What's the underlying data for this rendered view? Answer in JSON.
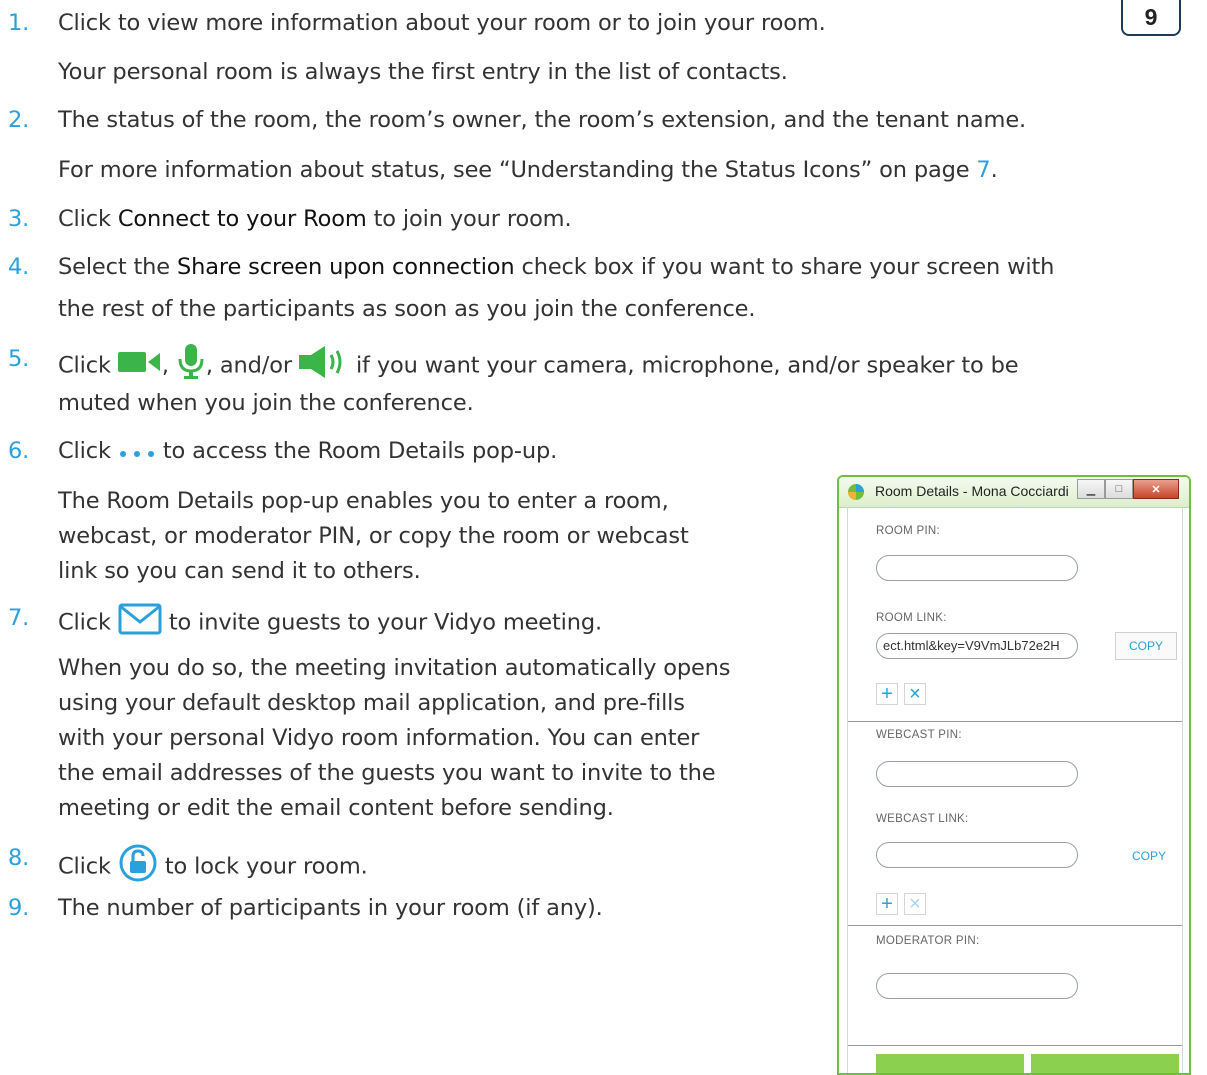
{
  "page_number": "9",
  "items": [
    {
      "num": "1.",
      "lines": [
        {
          "parts": [
            {
              "t": "Click to view more information about your room or to join your room."
            }
          ]
        },
        {
          "parts": [
            {
              "t": "Your personal room is always the first entry in the list of contacts."
            }
          ]
        }
      ]
    },
    {
      "num": "2.",
      "lines": [
        {
          "parts": [
            {
              "t": "The status of the room, the room’s owner, the room’s extension, and the tenant name."
            }
          ]
        },
        {
          "parts": [
            {
              "t": "For more information about status, see “Understanding the Status Icons” on page "
            },
            {
              "t": "7",
              "c": "blue"
            },
            {
              "t": "."
            }
          ]
        }
      ]
    },
    {
      "num": "3.",
      "lines": [
        {
          "parts": [
            {
              "t": "Click "
            },
            {
              "t": "Connect to your Room",
              "c": "hl"
            },
            {
              "t": " to join your room."
            }
          ]
        }
      ]
    },
    {
      "num": "4.",
      "lines": [
        {
          "parts": [
            {
              "t": "Select the "
            },
            {
              "t": "Share screen upon connection",
              "c": "hl"
            },
            {
              "t": " check box if you want to share your screen with"
            }
          ]
        },
        {
          "parts": [
            {
              "t": "the rest of the participants as soon as you join the conference."
            }
          ]
        }
      ]
    },
    {
      "num": "5.",
      "lines": [
        {
          "parts": [
            {
              "t": "Click "
            },
            {
              "icon": "camera-icon"
            },
            {
              "t": ", "
            },
            {
              "icon": "microphone-icon"
            },
            {
              "t": ", and/or "
            },
            {
              "icon": "speaker-icon"
            },
            {
              "t": " if you want your camera, microphone, and/or speaker to be"
            }
          ]
        },
        {
          "parts": [
            {
              "t": "muted when you join the conference."
            }
          ]
        }
      ]
    },
    {
      "num": "6.",
      "lines": [
        {
          "parts": [
            {
              "t": "Click "
            },
            {
              "icon": "more-dots-icon"
            },
            {
              "t": " to access the Room Details pop-up."
            }
          ]
        },
        {
          "parts": [
            {
              "t": "The Room Details pop-up enables you to enter a room,"
            }
          ]
        },
        {
          "parts": [
            {
              "t": "webcast, or moderator PIN, or copy the room or webcast"
            }
          ]
        },
        {
          "parts": [
            {
              "t": "link so you can send it to others."
            }
          ]
        }
      ]
    },
    {
      "num": "7.",
      "lines": [
        {
          "parts": [
            {
              "t": "Click "
            },
            {
              "icon": "envelope-icon"
            },
            {
              "t": " to invite guests to your Vidyo meeting."
            }
          ]
        },
        {
          "parts": [
            {
              "t": "When you do so, the meeting invitation automatically opens"
            }
          ]
        },
        {
          "parts": [
            {
              "t": "using your default desktop mail application, and pre-fills"
            }
          ]
        },
        {
          "parts": [
            {
              "t": "with your personal Vidyo room information. You can enter"
            }
          ]
        },
        {
          "parts": [
            {
              "t": "the email addresses of the guests you want to invite to the"
            }
          ]
        },
        {
          "parts": [
            {
              "t": "meeting or edit the email content before sending."
            }
          ]
        }
      ]
    },
    {
      "num": "8.",
      "lines": [
        {
          "parts": [
            {
              "t": "Click "
            },
            {
              "icon": "lock-icon"
            },
            {
              "t": " to lock your room."
            }
          ]
        }
      ]
    },
    {
      "num": "9.",
      "lines": [
        {
          "parts": [
            {
              "t": "The number of participants in your room (if any)."
            }
          ]
        }
      ]
    }
  ],
  "dialog": {
    "title": "Room Details - Mona Cocciardi",
    "room_pin_label": "ROOM PIN:",
    "room_pin_value": "",
    "room_link_label": "ROOM LINK:",
    "room_link_value": "ect.html&key=V9VmJLb72e2H",
    "room_copy_label": "COPY",
    "webcast_pin_label": "WEBCAST PIN:",
    "webcast_pin_value": "",
    "webcast_link_label": "WEBCAST LINK:",
    "webcast_link_value": "",
    "webcast_copy_label": "COPY",
    "moderator_pin_label": "MODERATOR PIN:",
    "moderator_pin_value": "",
    "plus_glyph": "+",
    "x_glyph": "×"
  },
  "colors": {
    "accent": "#2aa1dc",
    "green": "#6fbf3d",
    "green_button": "#8bd04f"
  }
}
